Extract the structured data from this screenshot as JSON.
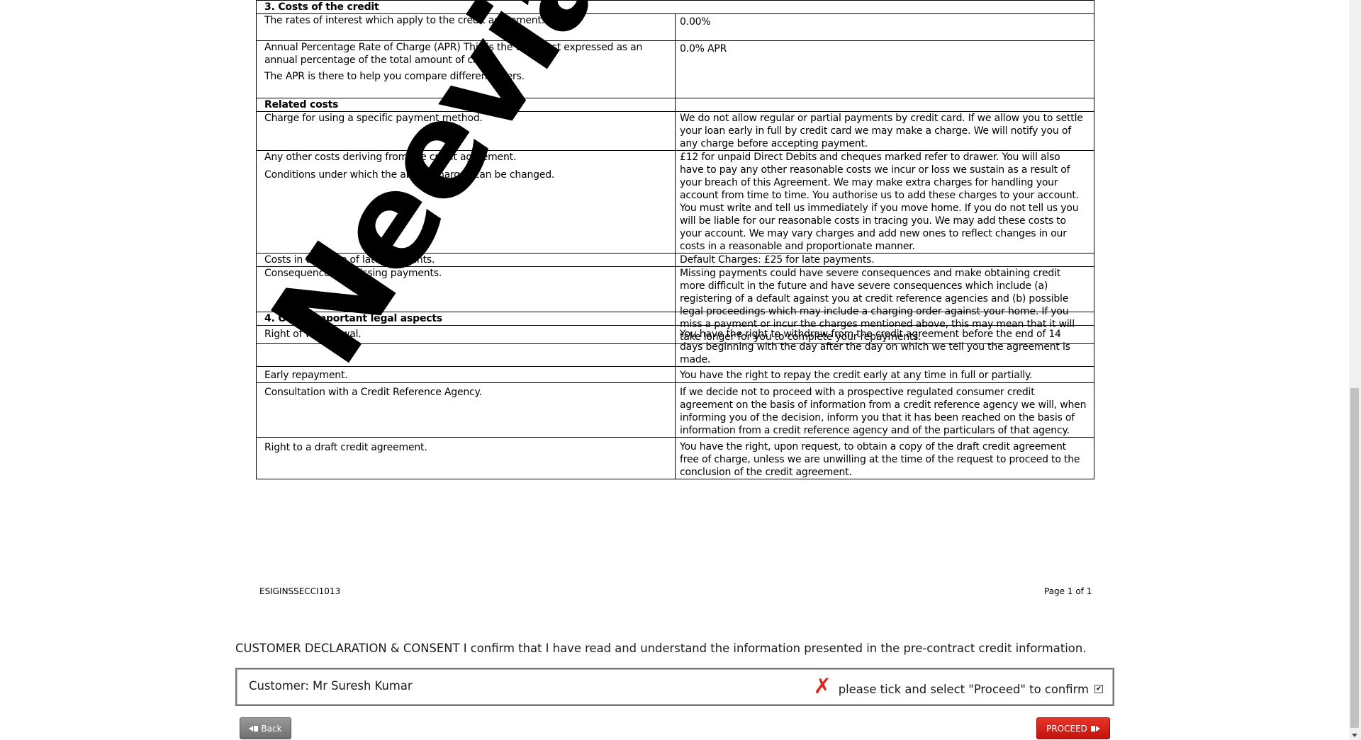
{
  "section3": {
    "title": "3. Costs of the credit",
    "rows": [
      {
        "left": [
          "The rates of interest which apply to the credit agreement."
        ],
        "right": "0.00%"
      },
      {
        "left": [
          "Annual Percentage Rate of Charge (APR) This is the total cost expressed as an annual percentage of the total amount of credit.",
          "The APR is there to help you compare different offers."
        ],
        "right": "0.0% APR"
      },
      {
        "header": "Related costs"
      },
      {
        "left": [
          "Charge for using a specific payment method."
        ],
        "right": "We do not allow regular or partial payments by credit card. If we allow you to settle your loan early in full by credit card we may make a charge. We will notify you of any charge before accepting payment."
      },
      {
        "left": [
          "Any other costs deriving from the credit agreement.",
          "Conditions under which the above charges can be changed."
        ],
        "right": "£12 for unpaid Direct Debits and cheques marked refer to drawer. You will also have to pay any other reasonable costs we incur or loss we sustain as a result of your breach of this Agreement. We may make extra charges for handling your account from time to time. You authorise us to add these charges to your account. You must write and tell us immediately if you move home. If you do not tell us you will be liable for our reasonable costs in tracing you. We may add these costs to your account. We may vary charges and add new ones to reflect changes in our costs in a reasonable and proportionate manner."
      },
      {
        "left": [
          "Costs in the case of late payments."
        ],
        "right": "Default Charges: £25 for late payments."
      },
      {
        "left": [
          "Consequences of missing payments."
        ],
        "right": "Missing payments could have severe consequences and make obtaining credit more difficult in the future and have severe consequences which include (a) registering of a default against you at credit reference agencies and (b) possible legal proceedings which may include a charging order against your home. If you miss a payment or incur the charges mentioned above, this may mean that it will take longer for you to complete your repayments."
      }
    ]
  },
  "section4": {
    "title": "4. Other important legal aspects",
    "rows": [
      {
        "left": "Right of withdrawal.",
        "right": "You have the right to withdraw from the credit agreement before the end of 14 days beginning with the day after the day on which we tell you the agreement is made."
      },
      {
        "left": "Early repayment.",
        "right": "You have the right to repay the credit early at any time in full or partially."
      },
      {
        "left": "Consultation with a Credit Reference Agency.",
        "right": "If we decide not to proceed with a prospective regulated consumer credit agreement on the basis of information from a credit reference agency we will, when informing you of the decision, inform you that it has been reached on the basis of information from a credit reference agency and of the particulars of that agency."
      },
      {
        "left": "Right to a draft credit agreement.",
        "right": "You have the right, upon request, to obtain a copy of the draft credit agreement free of charge, unless we are unwilling at the time of the request to proceed to the conclusion of the credit agreement."
      }
    ]
  },
  "footer": {
    "code": "ESIGINSSECCI1013",
    "page": "Page 1 of 1"
  },
  "watermark": "Neevia docC",
  "declaration": "CUSTOMER DECLARATION & CONSENT I confirm that I have read and understand the information presented in the pre-contract credit information.",
  "customer": "Customer: Mr Suresh Kumar",
  "tick_text": "please tick and select \"Proceed\" to confirm",
  "buttons": {
    "back": "Back",
    "proceed": "PROCEED"
  }
}
